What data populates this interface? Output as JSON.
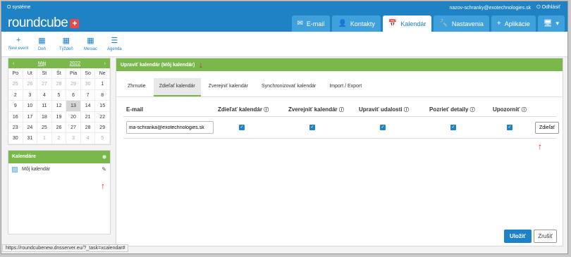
{
  "topbar": {
    "about": "O systéme",
    "user": "nazov-schranky@exotechnologies.sk",
    "logout": "Odhlásiť"
  },
  "logo": {
    "text": "roundcube",
    "plus": "+"
  },
  "nav": [
    {
      "label": "E-mail",
      "icon": "✉"
    },
    {
      "label": "Kontakty",
      "icon": "👤"
    },
    {
      "label": "Kalendár",
      "icon": "📅"
    },
    {
      "label": "Nastavenia",
      "icon": "🔧"
    },
    {
      "label": "Aplikácie",
      "icon": "+"
    },
    {
      "label": "",
      "icon": "🖥"
    }
  ],
  "toolbar": [
    {
      "label": "New event",
      "icon": "+"
    },
    {
      "label": "Deň",
      "icon": "▦"
    },
    {
      "label": "Týždeň",
      "icon": "▦"
    },
    {
      "label": "Mesiac",
      "icon": "▦"
    },
    {
      "label": "Agenda",
      "icon": "☰"
    }
  ],
  "calendar": {
    "month": "Máj",
    "year": "2022",
    "dows": [
      "Po",
      "Ut",
      "St",
      "Št",
      "Pia",
      "So",
      "Ne"
    ],
    "weeks": [
      [
        "25",
        "26",
        "27",
        "28",
        "29",
        "30",
        "1"
      ],
      [
        "2",
        "3",
        "4",
        "5",
        "6",
        "7",
        "8"
      ],
      [
        "9",
        "10",
        "11",
        "12",
        "13",
        "14",
        "15"
      ],
      [
        "16",
        "17",
        "18",
        "19",
        "20",
        "21",
        "22"
      ],
      [
        "23",
        "24",
        "25",
        "26",
        "27",
        "28",
        "29"
      ],
      [
        "30",
        "31",
        "1",
        "2",
        "3",
        "4",
        "5"
      ]
    ]
  },
  "calendars": {
    "title": "Kalendáre",
    "items": [
      {
        "label": "Môj kalendár"
      }
    ]
  },
  "main": {
    "title": "Upraviť kalendár (Môj kalendár)",
    "tabs": [
      "Zhrnutie",
      "Zdieľať kalendár",
      "Zverejniť kalendár",
      "Synchronizovať kalendár",
      "Import / Export"
    ],
    "columns": [
      "E-mail",
      "Zdieľať kalendár",
      "Zverejniť kalendár",
      "Upraviť udalosti",
      "Pozrieť detaily",
      "Upozorniť"
    ],
    "row": {
      "email": "ina-schranka@exotechnologies.sk",
      "share_button": "Zdieľať"
    },
    "save": "Uložiť",
    "cancel": "Zrušiť"
  },
  "status_url": "https://roundcubenew.dnsserver.eu/?_task=xcalendar#"
}
